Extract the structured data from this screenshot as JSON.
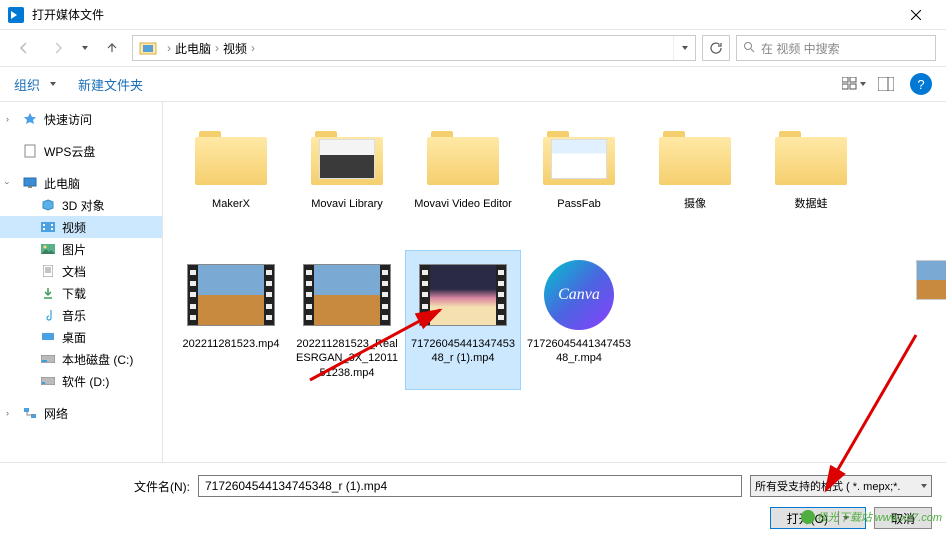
{
  "window": {
    "title": "打开媒体文件"
  },
  "breadcrumb": {
    "root": "此电脑",
    "current": "视频"
  },
  "search": {
    "placeholder": "在 视频 中搜索"
  },
  "toolbar": {
    "organize": "组织",
    "newFolder": "新建文件夹"
  },
  "sidebar": {
    "quickAccess": "快速访问",
    "wpsCloud": "WPS云盘",
    "thisPC": "此电脑",
    "pc": {
      "objects3d": "3D 对象",
      "videos": "视频",
      "pictures": "图片",
      "documents": "文档",
      "downloads": "下载",
      "music": "音乐",
      "desktop": "桌面",
      "localC": "本地磁盘 (C:)",
      "softD": "软件 (D:)"
    },
    "network": "网络"
  },
  "files": {
    "folders": [
      {
        "name": "MakerX"
      },
      {
        "name": "Movavi Library"
      },
      {
        "name": "Movavi Video Editor"
      },
      {
        "name": "PassFab"
      },
      {
        "name": "摄像"
      },
      {
        "name": "数据蛙"
      }
    ],
    "videos": [
      {
        "name": "202211281523.mp4"
      },
      {
        "name": "202211281523_RealESRGAN_3X_1201151238.mp4"
      },
      {
        "name": "7172604544134745348_r (1).mp4",
        "selected": true
      },
      {
        "name": "7172604544134745348_r.mp4",
        "canva": true
      }
    ]
  },
  "footer": {
    "fnameLabel": "文件名(N):",
    "fnameValue": "7172604544134745348_r (1).mp4",
    "filter": "所有受支持的格式 ( *. mepx;*.",
    "open": "打开(O)",
    "cancel": "取消"
  },
  "watermark": "极光下载站 www.xz7.com"
}
